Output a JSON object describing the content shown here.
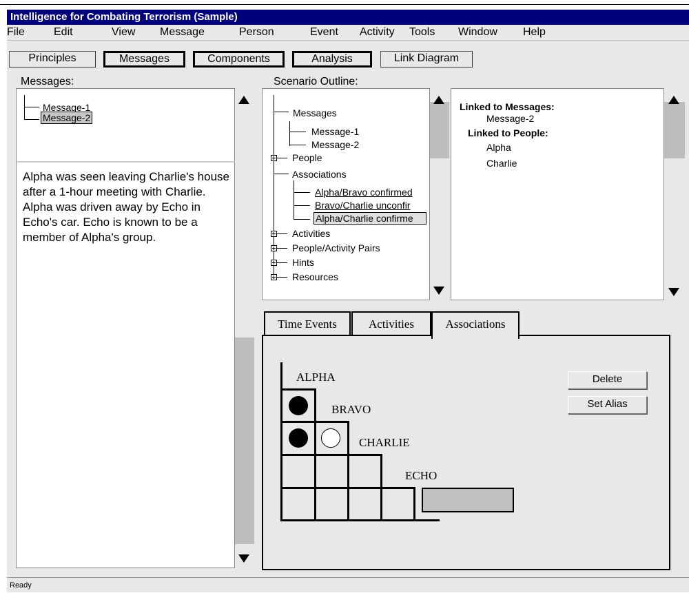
{
  "app": {
    "title": "Intelligence for Combating Terrorism  (Sample)"
  },
  "menu": [
    "File",
    "Edit",
    "View",
    "Message",
    "Person",
    "Event",
    "Activity",
    "Tools",
    "Window",
    "Help"
  ],
  "toolbar": [
    "Principles",
    "Messages",
    "Components",
    "Analysis",
    "Link Diagram"
  ],
  "messages_panel": {
    "label": "Messages:",
    "items": [
      "Message-1",
      "Message-2"
    ],
    "selected": "Message-2",
    "body": "Alpha was seen leaving Charlie's house after a 1-hour meeting with Charlie.  Alpha was driven away by Echo in Echo's car.  Echo is known to be a member of Alpha's group."
  },
  "outline_panel": {
    "label": "Scenario Outline:",
    "tree": {
      "messages": "Messages",
      "message_children": [
        "Message-1",
        "Message-2"
      ],
      "people": "People",
      "associations": "Associations",
      "association_children": [
        "Alpha/Bravo confirmed",
        "Bravo/Charlie unconfir",
        "Alpha/Charlie confirme"
      ],
      "activities": "Activities",
      "pairs": "People/Activity Pairs",
      "hints": "Hints",
      "resources": "Resources"
    }
  },
  "details_panel": {
    "linked_messages_label": "Linked to Messages:",
    "linked_messages": [
      "Message-2"
    ],
    "linked_people_label": "Linked to People:",
    "linked_people": [
      "Alpha",
      "Charlie"
    ]
  },
  "tabs": [
    "Time Events",
    "Activities",
    "Associations"
  ],
  "active_tab": "Associations",
  "matrix": {
    "names": [
      "ALPHA",
      "BRAVO",
      "CHARLIE",
      "ECHO"
    ],
    "cells": [
      {
        "pair": "Alpha/Bravo",
        "status": "confirmed"
      },
      {
        "pair": "Alpha/Charlie",
        "status": "confirmed"
      },
      {
        "pair": "Bravo/Charlie",
        "status": "unconfirmed"
      }
    ]
  },
  "buttons": {
    "delete": "Delete",
    "set_alias": "Set Alias"
  },
  "status": "Ready"
}
